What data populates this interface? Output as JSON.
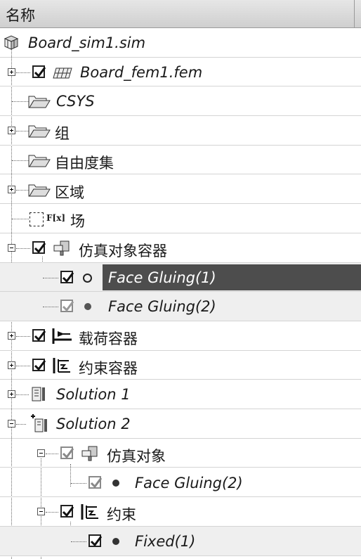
{
  "header": {
    "name_column": "名称"
  },
  "tree": {
    "sim": {
      "label": "Board_sim1.sim",
      "icon": "sim-file-icon"
    },
    "fem": {
      "label": "Board_fem1.fem",
      "icon": "mesh-grid-icon",
      "checked": true
    },
    "csys": {
      "label": "CSYS",
      "icon": "folder-open-icon"
    },
    "group": {
      "label": "组",
      "icon": "folder-open-icon"
    },
    "dof_set": {
      "label": "自由度集",
      "icon": "folder-open-icon"
    },
    "region": {
      "label": "区域",
      "icon": "folder-open-icon"
    },
    "field": {
      "label": "场",
      "icon": "field-fx-icon",
      "fx_text": "F[x]"
    },
    "sim_object_container": {
      "label": "仿真对象容器",
      "icon": "simulation-object-icon",
      "checked": true
    },
    "face_gluing_1": {
      "label": "Face Gluing(1)",
      "checked": true,
      "selected": true
    },
    "face_gluing_2": {
      "label": "Face Gluing(2)",
      "checked": true,
      "inactive": true
    },
    "load_container": {
      "label": "载荷容器",
      "icon": "load-icon",
      "checked": true
    },
    "constraint_container": {
      "label": "约束容器",
      "icon": "constraint-icon",
      "checked": true
    },
    "solution_1": {
      "label": "Solution 1",
      "icon": "solution-icon"
    },
    "solution_2": {
      "label": "Solution 2",
      "icon": "active-solution-icon"
    },
    "sol2_sim_objects": {
      "label": "仿真对象",
      "icon": "simulation-object-icon",
      "checked": true
    },
    "sol2_face_gluing_2": {
      "label": "Face Gluing(2)",
      "checked": true
    },
    "sol2_constraints": {
      "label": "约束",
      "icon": "constraint-icon",
      "checked": true
    },
    "sol2_fixed_1": {
      "label": "Fixed(1)",
      "checked": true
    }
  },
  "colors": {
    "selection": "#4d4d4d",
    "row_shade": "#efefef",
    "header": "#d9d9d9"
  }
}
